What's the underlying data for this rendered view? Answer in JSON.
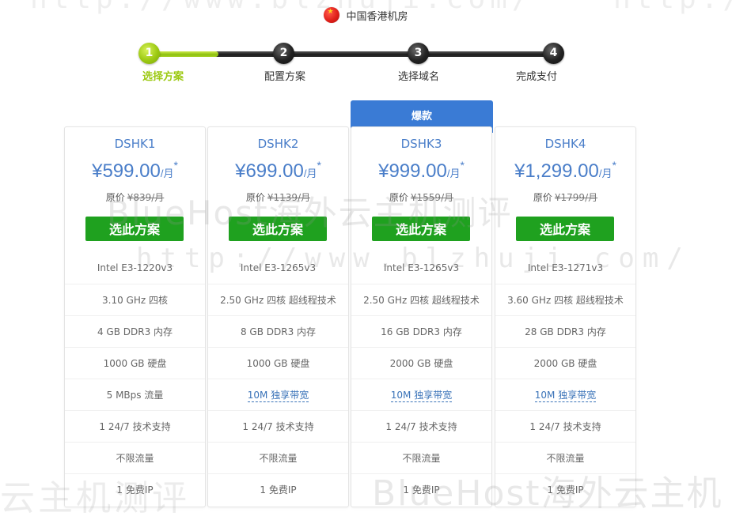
{
  "header": {
    "flag_icon": "china-flag-icon",
    "location": "中国香港机房"
  },
  "steps": [
    {
      "number": "1",
      "label": "选择方案",
      "active": true
    },
    {
      "number": "2",
      "label": "配置方案",
      "active": false
    },
    {
      "number": "3",
      "label": "选择域名",
      "active": false
    },
    {
      "number": "4",
      "label": "完成支付",
      "active": false
    }
  ],
  "colors": {
    "accent_green": "#9cc912",
    "button_green": "#1fa11f",
    "plan_blue": "#4a7ec9",
    "badge_blue": "#3a7bd5"
  },
  "featured_badge": "爆款",
  "watermarks": {
    "top_left": "http://www.blzhuji.com/",
    "top_right": "http://",
    "mid": "BlueHost海外云主机测评",
    "url": "http://www.blzhuji.com/",
    "bottom_left": "云主机测评",
    "bottom_right": "BlueHost海外云主机"
  },
  "plans": [
    {
      "name": "DSHK1",
      "currency": "¥",
      "price": "599.00",
      "unit": "/月",
      "mark": "*",
      "orig_label": "原价",
      "orig_price": "¥839/月",
      "button": "选此方案",
      "features": [
        {
          "text": "Intel E3-1220v3",
          "link": false
        },
        {
          "text": "3.10 GHz 四核",
          "link": false
        },
        {
          "text": "4 GB DDR3 内存",
          "link": false
        },
        {
          "text": "1000 GB 硬盘",
          "link": false
        },
        {
          "text": "5 MBps 流量",
          "link": false
        },
        {
          "text": "1 24/7 技术支持",
          "link": false
        },
        {
          "text": "不限流量",
          "link": false
        },
        {
          "text": "1 免费IP",
          "link": false
        }
      ]
    },
    {
      "name": "DSHK2",
      "currency": "¥",
      "price": "699.00",
      "unit": "/月",
      "mark": "*",
      "orig_label": "原价",
      "orig_price": "¥1139/月",
      "button": "选此方案",
      "features": [
        {
          "text": "Intel E3-1265v3",
          "link": false
        },
        {
          "text": "2.50 GHz 四核 超线程技术",
          "link": false
        },
        {
          "text": "8 GB DDR3 内存",
          "link": false
        },
        {
          "text": "1000 GB 硬盘",
          "link": false
        },
        {
          "text": "10M 独享带宽",
          "link": true
        },
        {
          "text": "1 24/7 技术支持",
          "link": false
        },
        {
          "text": "不限流量",
          "link": false
        },
        {
          "text": "1 免费IP",
          "link": false
        }
      ]
    },
    {
      "name": "DSHK3",
      "currency": "¥",
      "price": "999.00",
      "unit": "/月",
      "mark": "*",
      "orig_label": "原价",
      "orig_price": "¥1559/月",
      "button": "选此方案",
      "features": [
        {
          "text": "Intel E3-1265v3",
          "link": false
        },
        {
          "text": "2.50 GHz 四核 超线程技术",
          "link": false
        },
        {
          "text": "16 GB DDR3 内存",
          "link": false
        },
        {
          "text": "2000 GB 硬盘",
          "link": false
        },
        {
          "text": "10M 独享带宽",
          "link": true
        },
        {
          "text": "1 24/7 技术支持",
          "link": false
        },
        {
          "text": "不限流量",
          "link": false
        },
        {
          "text": "1 免费IP",
          "link": false
        }
      ]
    },
    {
      "name": "DSHK4",
      "currency": "¥",
      "price": "1,299.00",
      "unit": "/月",
      "mark": "*",
      "orig_label": "原价",
      "orig_price": "¥1799/月",
      "button": "选此方案",
      "features": [
        {
          "text": "Intel E3-1271v3",
          "link": false
        },
        {
          "text": "3.60 GHz 四核 超线程技术",
          "link": false
        },
        {
          "text": "28 GB DDR3 内存",
          "link": false
        },
        {
          "text": "2000 GB 硬盘",
          "link": false
        },
        {
          "text": "10M 独享带宽",
          "link": true
        },
        {
          "text": "1 24/7 技术支持",
          "link": false
        },
        {
          "text": "不限流量",
          "link": false
        },
        {
          "text": "1 免费IP",
          "link": false
        }
      ]
    }
  ]
}
